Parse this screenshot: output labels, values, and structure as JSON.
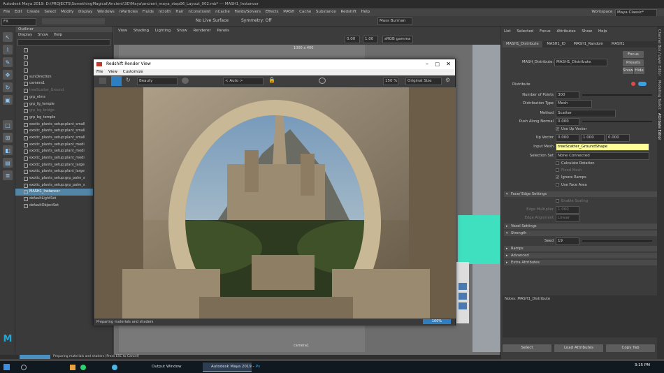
{
  "window_title": "Autodesk Maya 2019: D:\\PROJECTS\\SomethingMagical\\Ancient\\3D\\Maya\\ancient_maya_step06_Layout_002.mb* --- MASH1_Instancer",
  "menubar": [
    "File",
    "Edit",
    "Create",
    "Select",
    "Modify",
    "Display",
    "Windows",
    "nParticles",
    "Fluids",
    "nCloth",
    "Hair",
    "nConstraint",
    "nCache",
    "Fields/Solvers",
    "Effects",
    "MASH",
    "Cache",
    "Substance",
    "Redshift",
    "Help"
  ],
  "workspace_label": "Workspace :",
  "workspace_value": "Maya Classic*",
  "mode_menu": "FX",
  "symmetry": "Symmetry: Off",
  "no_live": "No Live Surface",
  "user_menu": "Mass Burman",
  "outliner": {
    "title": "Outliner",
    "menu": [
      "Display",
      "Show",
      "Help"
    ],
    "items": [
      {
        "label": "",
        "sel": false,
        "dim": true
      },
      {
        "label": "",
        "sel": false,
        "dim": true
      },
      {
        "label": "",
        "sel": false,
        "dim": true
      },
      {
        "label": "",
        "sel": false,
        "dim": true
      },
      {
        "label": "sunDirection",
        "sel": false,
        "dim": false
      },
      {
        "label": "camera1",
        "sel": false,
        "dim": false
      },
      {
        "label": "treeScatter_Ground",
        "sel": false,
        "dim": true
      },
      {
        "label": "grp_elms",
        "sel": false,
        "dim": false
      },
      {
        "label": "grp_fg_temple",
        "sel": false,
        "dim": false
      },
      {
        "label": "grp_bg_bridge",
        "sel": false,
        "dim": true
      },
      {
        "label": "grp_bg_temple",
        "sel": false,
        "dim": false
      },
      {
        "label": "exotic_plants_setup:plant_small",
        "sel": false,
        "dim": false
      },
      {
        "label": "exotic_plants_setup:plant_small",
        "sel": false,
        "dim": false
      },
      {
        "label": "exotic_plants_setup:plant_small",
        "sel": false,
        "dim": false
      },
      {
        "label": "exotic_plants_setup:plant_medi",
        "sel": false,
        "dim": false
      },
      {
        "label": "exotic_plants_setup:plant_medi",
        "sel": false,
        "dim": false
      },
      {
        "label": "exotic_plants_setup:plant_medi",
        "sel": false,
        "dim": false
      },
      {
        "label": "exotic_plants_setup:plant_large",
        "sel": false,
        "dim": false
      },
      {
        "label": "exotic_plants_setup:plant_large",
        "sel": false,
        "dim": false
      },
      {
        "label": "exotic_plants_setup:grp_palm_s",
        "sel": false,
        "dim": false
      },
      {
        "label": "exotic_plants_setup:grp_palm_s",
        "sel": false,
        "dim": false
      },
      {
        "label": "MASH1_Instancer",
        "sel": true,
        "dim": false
      },
      {
        "label": "defaultLightSet",
        "sel": false,
        "dim": false
      },
      {
        "label": "defaultObjectSet",
        "sel": false,
        "dim": false
      }
    ]
  },
  "viewport": {
    "menu": [
      "View",
      "Shading",
      "Lighting",
      "Show",
      "Renderer",
      "Panels"
    ],
    "resolution": "1000 x 400",
    "camera": "camera1",
    "gamma": "sRGB gamma",
    "field1": "0.00",
    "field2": "1.00"
  },
  "render_view": {
    "title": "Redshift Render View",
    "menu": [
      "File",
      "View",
      "Customize"
    ],
    "aov": "Beauty",
    "auto": "< Auto >",
    "zoom": "150 %",
    "size": "Original Size",
    "status": "Preparing materials and shaders",
    "progress": "100%"
  },
  "attr_editor": {
    "menu": [
      "List",
      "Selected",
      "Focus",
      "Attributes",
      "Show",
      "Help"
    ],
    "tabs": [
      "MASH1_Distribute",
      "MASH1_ID",
      "MASH1_Random",
      "MASH1"
    ],
    "node_label": "MASH_Distribute:",
    "node_value": "MASH1_Distribute",
    "focus": "Focus",
    "presets": "Presets",
    "show": "Show",
    "hide": "Hide",
    "section_title": "Distribute",
    "fields": [
      {
        "label": "Number of Points",
        "value": "300"
      },
      {
        "label": "Distribution Type",
        "value": "Mesh"
      },
      {
        "label": "Method",
        "value": "Scatter"
      },
      {
        "label": "Push Along Normal",
        "value": "0.000"
      }
    ],
    "use_up_vector": "Use Up Vector",
    "up_vector_label": "Up Vector",
    "up_vector": [
      "0.000",
      "1.000",
      "0.000"
    ],
    "input_mesh_label": "Input Mesh",
    "input_mesh": "treeScatter_GroundShape",
    "selection_set_label": "Selection Set",
    "selection_set": "None Connected",
    "checks": [
      {
        "label": "Calculate Rotation",
        "on": false,
        "dim": false
      },
      {
        "label": "Flood Mesh",
        "on": false,
        "dim": true
      },
      {
        "label": "Ignore Ramps",
        "on": true,
        "dim": false
      },
      {
        "label": "Use Face Area",
        "on": false,
        "dim": false
      }
    ],
    "face_edge_section": "Face/ Edge Settings",
    "enable_scaling": "Enable Scaling",
    "edge_multiplier": "Edge Multiplier",
    "edge_multiplier_value": "1.000",
    "edge_alignment": "Edge Alignment",
    "edge_alignment_value": "Linear",
    "sections": [
      "Voxel Settings",
      "Strength"
    ],
    "seed_label": "Seed",
    "seed_value": "19",
    "more_sections": [
      "Ramps",
      "Advanced",
      "Extra Attributes"
    ],
    "notes": "Notes:  MASH1_Distribute",
    "select": "Select",
    "load": "Load Attributes",
    "copy": "Copy Tab"
  },
  "side_tabs": [
    "Channel Box / Layer Editor",
    "Modelling Toolkit",
    "Attribute Editor"
  ],
  "status_line": "Preparing materials and shaders (Press ESC to Cancel)",
  "taskbar": {
    "items": [
      "Output Window",
      "Autodesk Maya 2019 -",
      "Ps"
    ],
    "time": "3:15 PM"
  },
  "colors": {
    "selection": "#5285a6",
    "accent": "#8ecbff",
    "mesh_field": "#ffff99"
  }
}
